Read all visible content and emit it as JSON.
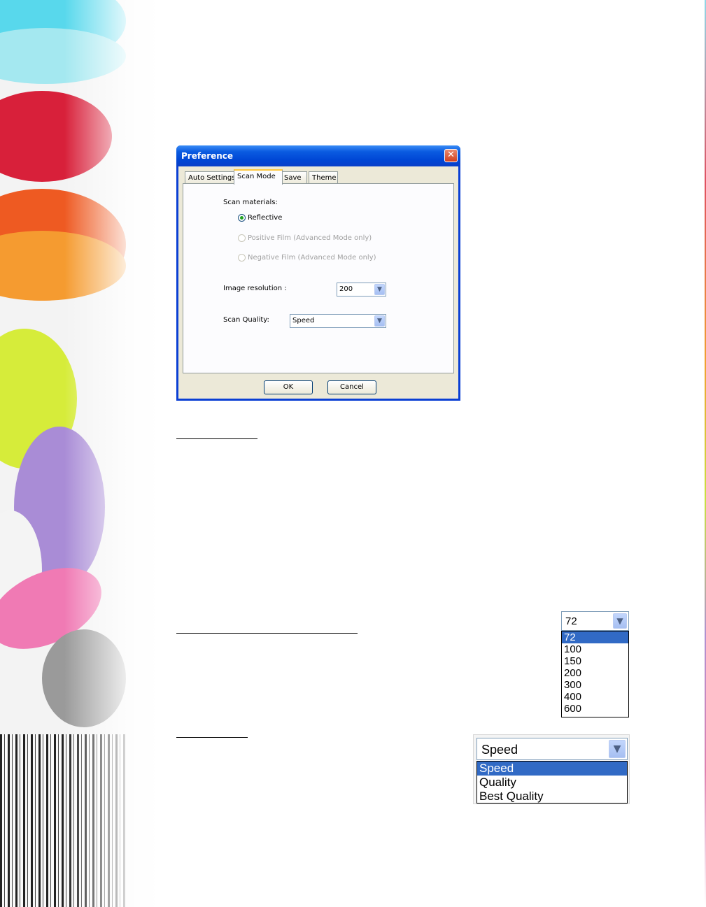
{
  "dialog": {
    "title": "Preference",
    "close_glyph": "✕",
    "tabs": [
      "Auto Settings",
      "Scan Mode",
      "Save",
      "Theme"
    ],
    "active_tab": "Scan Mode",
    "scan_materials_label": "Scan materials:",
    "radios": [
      {
        "label": "Reflective",
        "selected": true,
        "enabled": true
      },
      {
        "label": "Positive Film (Advanced Mode only)",
        "selected": false,
        "enabled": false
      },
      {
        "label": "Negative Film (Advanced Mode only)",
        "selected": false,
        "enabled": false
      }
    ],
    "resolution_label": "Image resolution :",
    "resolution_value": "200",
    "quality_label": "Scan Quality:",
    "quality_value": "Speed",
    "ok_label": "OK",
    "cancel_label": "Cancel"
  },
  "resolution_dropdown": {
    "current": "72",
    "options": [
      "72",
      "100",
      "150",
      "200",
      "300",
      "400",
      "600"
    ],
    "highlighted": "72"
  },
  "quality_dropdown": {
    "current": "Speed",
    "options": [
      "Speed",
      "Quality",
      "Best Quality"
    ],
    "highlighted": "Speed"
  },
  "colors": {
    "title_blue": "#0a3fd4",
    "selection_blue": "#316ac5",
    "dialog_face": "#ece9d8"
  }
}
